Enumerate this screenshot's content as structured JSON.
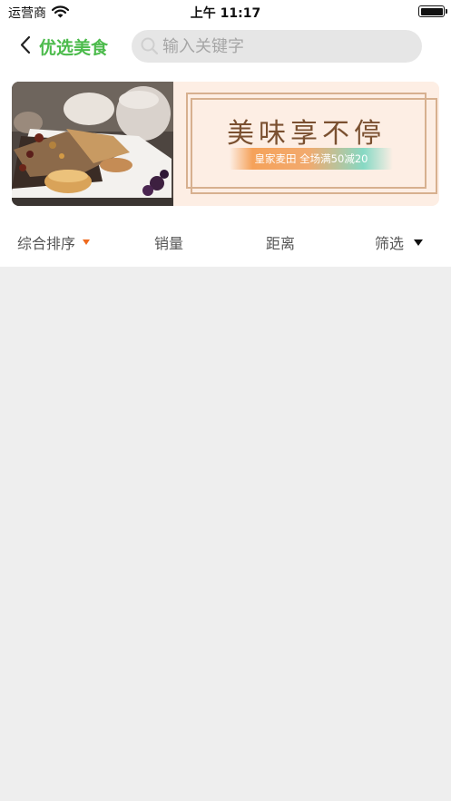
{
  "status_bar": {
    "carrier": "运营商",
    "time": "上午 11:17",
    "battery_level": 1.0,
    "icons": [
      "wifi-icon",
      "battery-icon"
    ]
  },
  "nav": {
    "back_icon": "chevron-left-icon",
    "title": "优选美食",
    "title_color": "#4cbb4c"
  },
  "search": {
    "placeholder": "输入关键字",
    "value": "",
    "icon": "search-icon"
  },
  "banner": {
    "headline": "美味享不停",
    "subline": "皇家麦田  全场满50减20"
  },
  "filters": [
    {
      "label": "综合排序",
      "indicator": "caret-down-icon",
      "indicator_color": "#ef6a1e"
    },
    {
      "label": "销量"
    },
    {
      "label": "距离"
    },
    {
      "label": "筛选",
      "indicator": "caret-down-icon",
      "indicator_color": "#111111"
    }
  ],
  "colors": {
    "background": "#eeeeee",
    "accent_green": "#4cbb4c",
    "accent_orange": "#ef6a1e"
  }
}
